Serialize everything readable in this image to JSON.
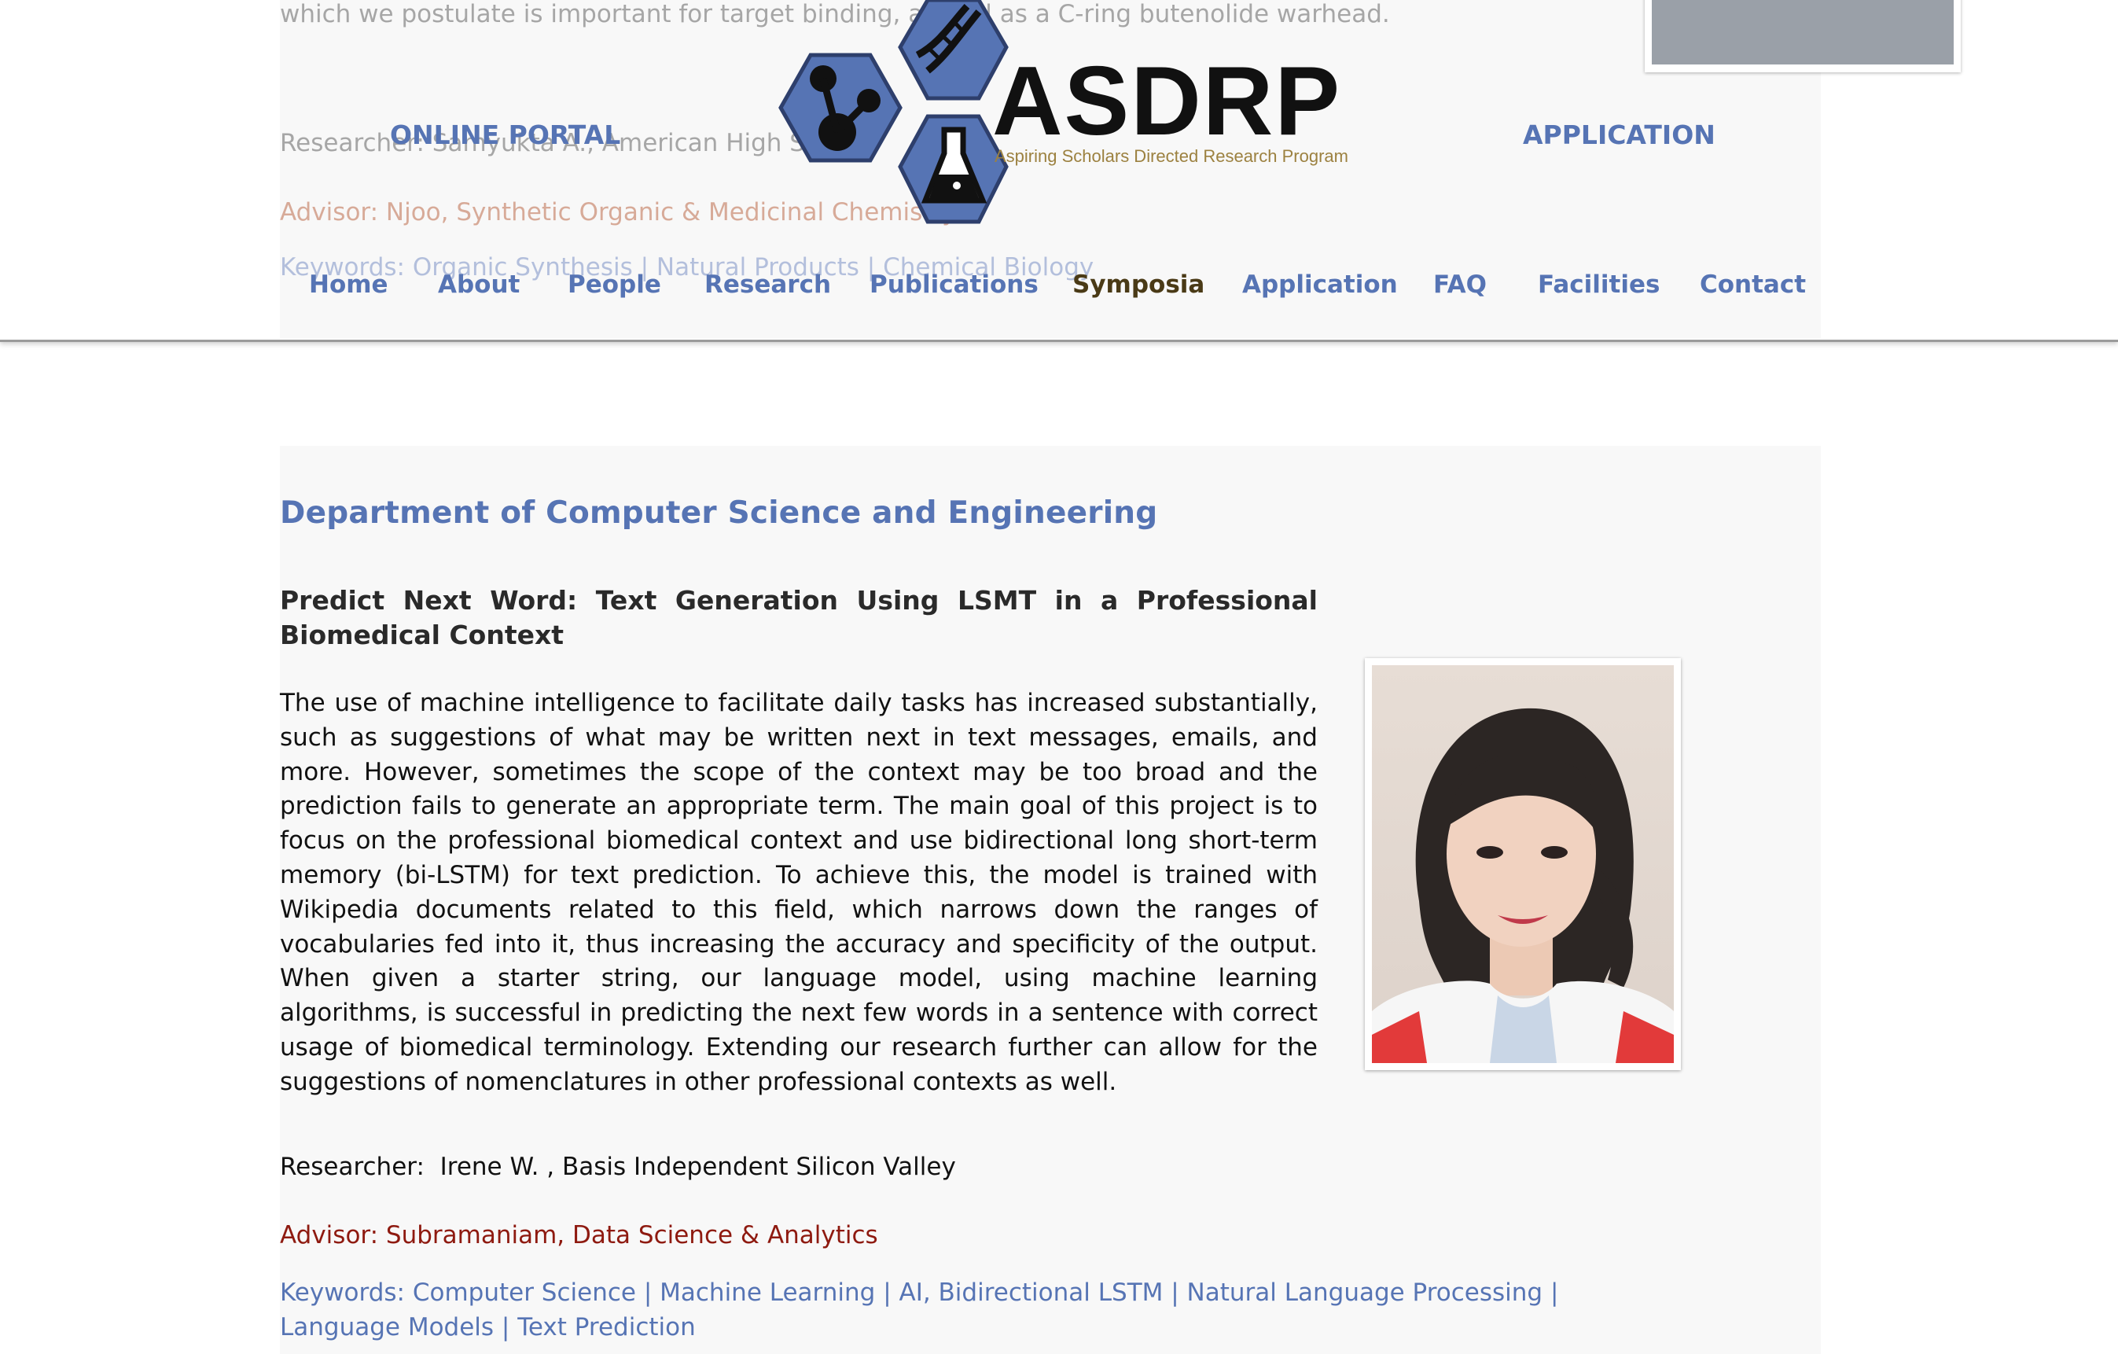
{
  "header": {
    "portal_label": "ONLINE PORTAL",
    "application_label": "APPLICATION",
    "logo_title": "ASDRP",
    "logo_subtitle": "Aspiring Scholars Directed Research Program",
    "nav": [
      "Home",
      "About",
      "People",
      "Research",
      "Publications",
      "Symposia",
      "Application",
      "FAQ",
      "Facilities",
      "Contact"
    ],
    "active_nav": "Symposia"
  },
  "previous_entry": {
    "text_line": "which we postulate is important for target binding, as well as a C-ring butenolide warhead.",
    "researcher": "Researcher:  Samyukta A., American High School",
    "advisor": "Advisor: Njoo, Synthetic Organic & Medicinal Chemistry",
    "keywords": "Keywords: Organic Synthesis | Natural Products | Chemical Biology"
  },
  "section": {
    "department": "Department of Computer Science and Engineering",
    "project_title": "Predict Next Word: Text Generation Using LSMT in a Professional Biomedical Context",
    "abstract": "The use of machine intelligence to facilitate daily tasks has increased substantially, such as suggestions of what may be written next in text messages, emails, and more. However, sometimes the scope of the context may be too broad and the prediction fails to generate an appropriate term. The main goal of this project is to focus on the professional biomedical context and use bidirectional long short-term memory (bi-LSTM) for text prediction. To achieve this, the model is trained with Wikipedia documents related to this field, which narrows down the ranges of vocabularies fed into it, thus increasing the accuracy and specificity of the output. When given a starter string, our language model, using machine learning algorithms, is successful in predicting the next few words in a sentence with correct usage of biomedical terminology. Extending our research further can allow for the suggestions of nomenclatures in other professional contexts as well.",
    "researcher": "Researcher:  Irene W. , Basis Independent Silicon Valley",
    "advisor": "Advisor: Subramaniam, Data Science & Analytics",
    "keywords": "Keywords: Computer Science | Machine Learning | AI, Bidirectional LSTM | Natural Language Processing | Language Models | Text Prediction"
  },
  "colors": {
    "brand_blue": "#5674b4",
    "advisor_red": "#8e1a10",
    "active_nav": "#4a3a16",
    "logo_gold": "#9c8140"
  }
}
